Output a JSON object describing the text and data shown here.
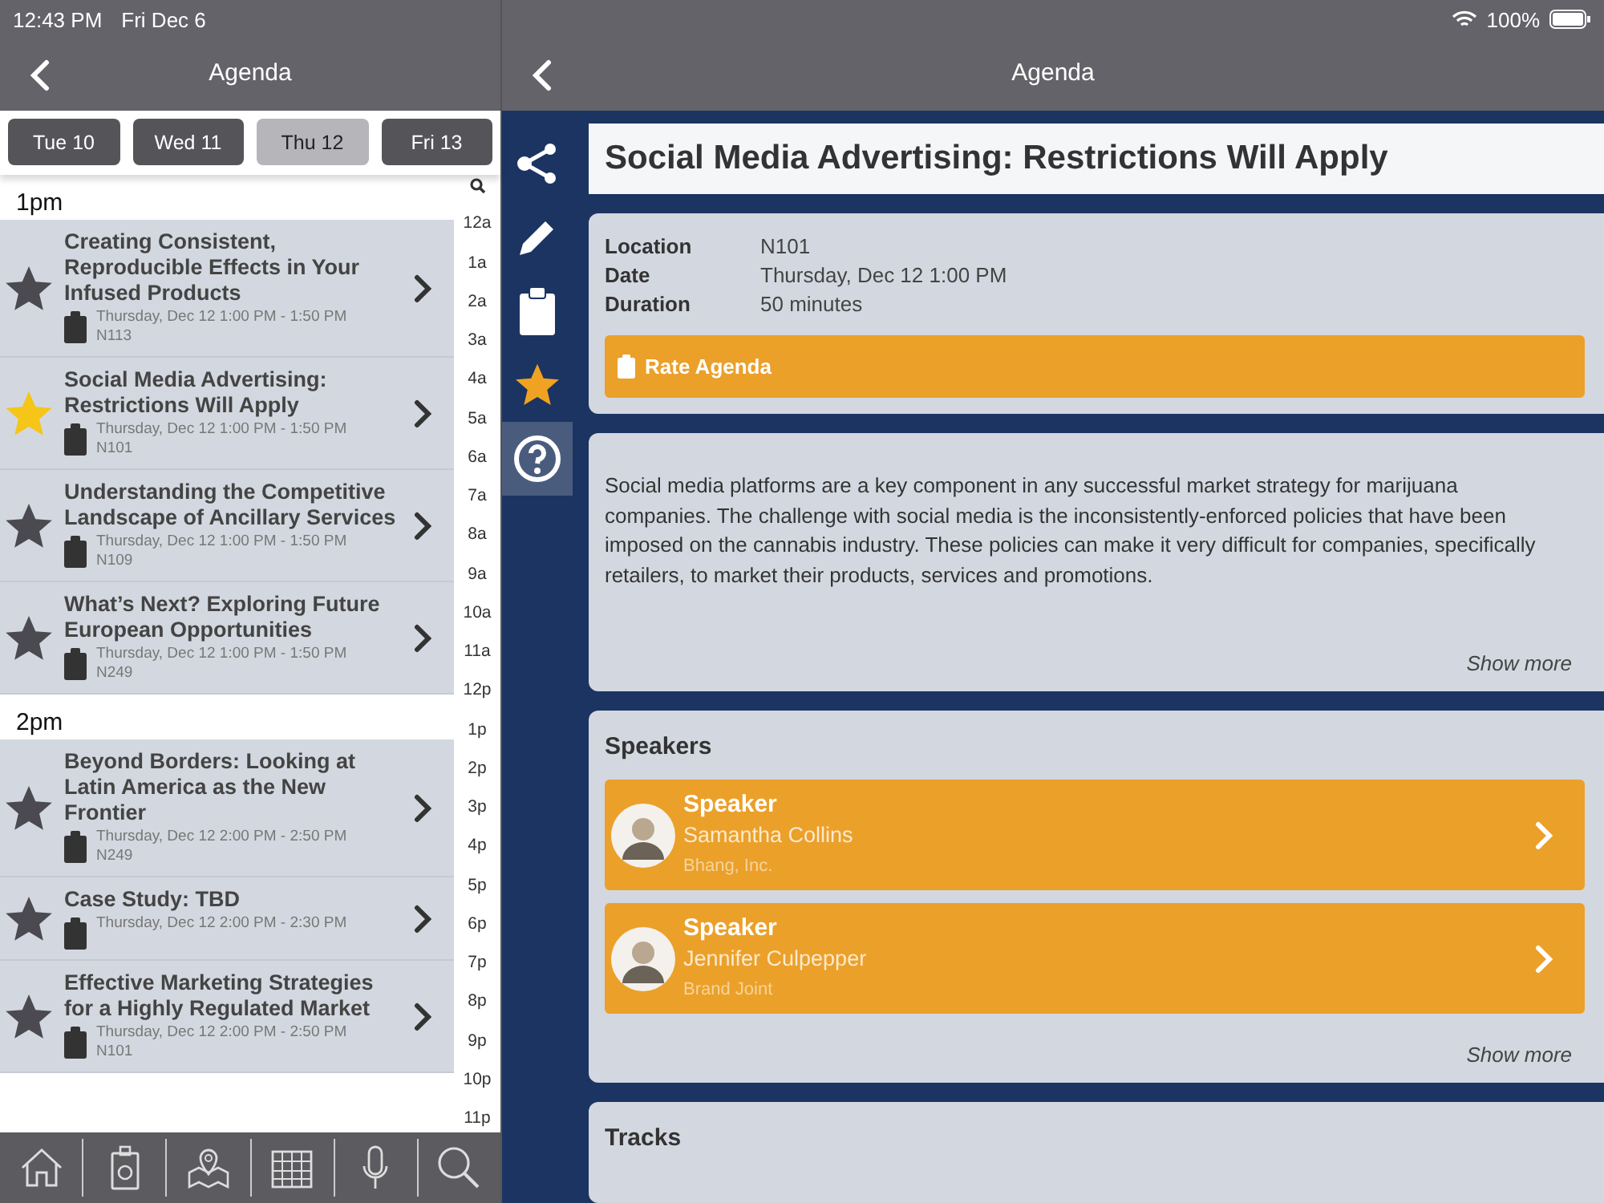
{
  "status_bar": {
    "time": "12:43 PM",
    "date": "Fri Dec 6",
    "battery": "100%"
  },
  "left_nav": {
    "title": "Agenda"
  },
  "right_nav": {
    "title": "Agenda"
  },
  "day_tabs": [
    {
      "label": "Tue 10",
      "selected": false
    },
    {
      "label": "Wed 11",
      "selected": false
    },
    {
      "label": "Thu 12",
      "selected": true
    },
    {
      "label": "Fri 13",
      "selected": false
    }
  ],
  "sections": [
    {
      "heading": "1pm",
      "sessions": [
        {
          "title": "Creating Consistent, Reproducible Effects in Your Infused Products",
          "time": "Thursday, Dec 12 1:00 PM - 1:50 PM",
          "room": "N113",
          "favorite": false
        },
        {
          "title": "Social Media Advertising: Restrictions Will Apply",
          "time": "Thursday, Dec 12 1:00 PM - 1:50 PM",
          "room": "N101",
          "favorite": true
        },
        {
          "title": "Understanding the Competitive Landscape of Ancillary Services",
          "time": "Thursday, Dec 12 1:00 PM - 1:50 PM",
          "room": "N109",
          "favorite": false
        },
        {
          "title": "What’s Next? Exploring Future European Opportunities",
          "time": "Thursday, Dec 12 1:00 PM - 1:50 PM",
          "room": "N249",
          "favorite": false
        }
      ]
    },
    {
      "heading": "2pm",
      "sessions": [
        {
          "title": "Beyond Borders: Looking at Latin America as the New Frontier",
          "time": "Thursday, Dec 12 2:00 PM - 2:50 PM",
          "room": "N249",
          "favorite": false
        },
        {
          "title": "Case Study: TBD",
          "time": "Thursday, Dec 12 2:00 PM - 2:30 PM",
          "favorite": false
        },
        {
          "title": "Effective Marketing Strategies for a Highly Regulated Market",
          "time": "Thursday, Dec 12 2:00 PM - 2:50 PM",
          "room": "N101",
          "favorite": false
        }
      ]
    }
  ],
  "hour_index": [
    "12a",
    "1a",
    "2a",
    "3a",
    "4a",
    "5a",
    "6a",
    "7a",
    "8a",
    "9a",
    "10a",
    "11a",
    "12p",
    "1p",
    "2p",
    "3p",
    "4p",
    "5p",
    "6p",
    "7p",
    "8p",
    "9p",
    "10p",
    "11p"
  ],
  "tab_bar": [
    {
      "kind": "home"
    },
    {
      "kind": "badge"
    },
    {
      "kind": "map"
    },
    {
      "kind": "calendar"
    },
    {
      "kind": "microphone"
    },
    {
      "kind": "search"
    }
  ],
  "side_actions": [
    {
      "kind": "share",
      "selected": false
    },
    {
      "kind": "pencil",
      "selected": false
    },
    {
      "kind": "clipboard",
      "selected": false
    },
    {
      "kind": "star",
      "selected": false
    },
    {
      "kind": "help",
      "selected": true
    }
  ],
  "detail": {
    "title": "Social Media Advertising: Restrictions Will Apply",
    "fields": [
      {
        "label": "Location",
        "value": "N101"
      },
      {
        "label": "Date",
        "value": "Thursday, Dec 12 1:00 PM"
      },
      {
        "label": "Duration",
        "value": "50 minutes"
      }
    ],
    "rate_button": "Rate Agenda",
    "description": "Social media platforms are a key component in any successful market strategy for marijuana companies. The challenge with social media is the inconsistently-enforced policies that have been imposed on the cannabis industry. These policies can make it very difficult for companies, specifically retailers, to market their products, services and promotions.",
    "description_more": "Show more",
    "speakers_heading": "Speakers",
    "speakers": [
      {
        "role": "Speaker",
        "name": "Samantha Collins",
        "company": "Bhang, Inc."
      },
      {
        "role": "Speaker",
        "name": "Jennifer Culpepper",
        "company": "Brand Joint"
      }
    ],
    "speakers_more": "Show more",
    "tracks_heading": "Tracks"
  }
}
